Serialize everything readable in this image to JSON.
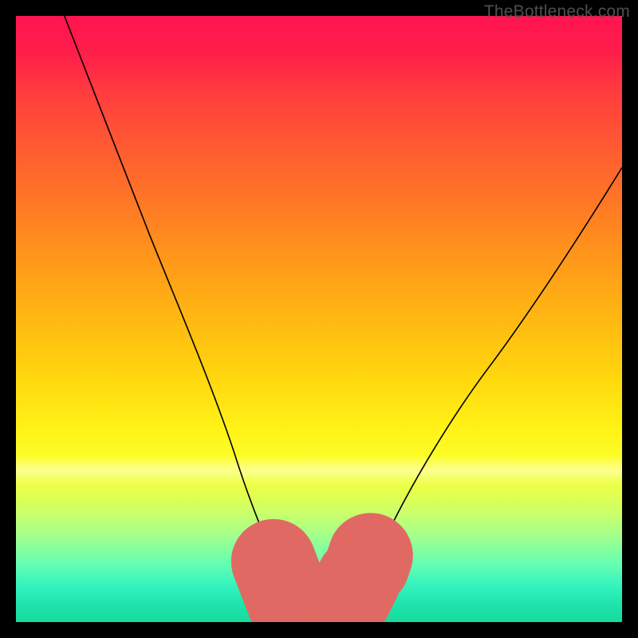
{
  "watermark": "TheBottleneck.com",
  "chart_data": {
    "type": "line",
    "title": "",
    "xlabel": "",
    "ylabel": "",
    "xlim": [
      0,
      100
    ],
    "ylim": [
      0,
      100
    ],
    "series": [
      {
        "name": "bottleneck-curve",
        "x": [
          8,
          15,
          22,
          30,
          36,
          40,
          44,
          46,
          48,
          52,
          54,
          56,
          60,
          68,
          78,
          88,
          100
        ],
        "y_from_top": [
          0,
          18,
          36,
          55,
          72,
          84,
          93,
          97,
          99,
          99,
          98,
          95,
          88,
          74,
          58,
          42,
          25
        ]
      }
    ],
    "overlay_segments": [
      {
        "name": "seg-left",
        "x1": 42.5,
        "y1": 90.0,
        "x2": 45.0,
        "y2": 96.5,
        "color": "#e06a63"
      },
      {
        "name": "seg-bottom",
        "x1": 46.0,
        "y1": 98.0,
        "x2": 53.5,
        "y2": 97.5,
        "color": "#e06a63"
      },
      {
        "name": "seg-right",
        "x1": 55.0,
        "y1": 96.0,
        "x2": 56.5,
        "y2": 93.0,
        "color": "#e06a63"
      },
      {
        "name": "seg-dot",
        "x1": 58.0,
        "y1": 90.5,
        "x2": 58.5,
        "y2": 89.0,
        "color": "#e06a63"
      }
    ],
    "gradient_stops": [
      {
        "pct": 0,
        "color": "#ff1450"
      },
      {
        "pct": 50,
        "color": "#ffd80e"
      },
      {
        "pct": 78,
        "color": "#e9ff48"
      },
      {
        "pct": 100,
        "color": "#18db9c"
      }
    ]
  }
}
